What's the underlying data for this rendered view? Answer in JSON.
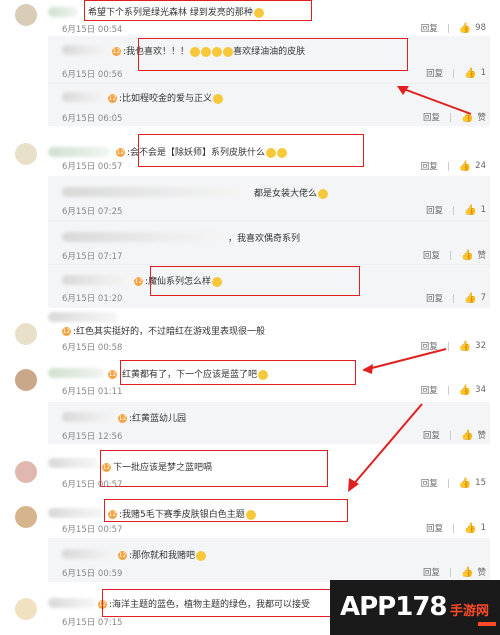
{
  "comments": [
    {
      "text": "希望下个系列是绿光森林 绿到发亮的那种",
      "time": "6月15日 00:54",
      "reply": "回复",
      "likes": "98",
      "replies": [
        {
          "text": "我也喜欢！！！",
          "text2": "喜欢绿油油的皮肤",
          "time": "6月15日 00:56",
          "reply": "回复",
          "likes": "1"
        },
        {
          "text": "比如程咬金的爱与正义",
          "time": "6月15日 06:05",
          "reply": "回复",
          "likes": "赞"
        }
      ]
    },
    {
      "text": "会不会是【除妖师】系列皮肤什么",
      "time": "6月15日 00:57",
      "reply": "回复",
      "likes": "24",
      "replies": [
        {
          "text": "都是女装大佬么",
          "time": "6月15日 07:25",
          "reply": "回复",
          "likes": "1"
        },
        {
          "text": "，我喜欢偶奇系列",
          "time": "6月15日 07:17",
          "reply": "回复",
          "likes": "赞"
        },
        {
          "text": "魔仙系列怎么样",
          "time": "6月15日 01:20",
          "reply": "回复",
          "likes": "7"
        }
      ]
    },
    {
      "text": "红色其实挺好的，不过暗红在游戏里表现很一般",
      "time": "6月15日 00:58",
      "reply": "回复",
      "likes": "32"
    },
    {
      "text": "红黄都有了，下一个应该是蓝了吧",
      "time": "6月15日 01:11",
      "reply": "回复",
      "likes": "34",
      "replies": [
        {
          "text": "红黄蓝幼儿园",
          "time": "6月15日 12:56",
          "reply": "回复",
          "likes": "赞"
        }
      ]
    },
    {
      "text": "下一批应该是梦之蓝吧嗝",
      "time": "6月15日 00:57",
      "reply": "回复",
      "likes": "15"
    },
    {
      "text": "我赌5毛下赛季皮肤银白色主题",
      "time": "6月15日 00:57",
      "reply": "回复",
      "likes": "1",
      "replies": [
        {
          "text": "那你就和我赌吧",
          "time": "6月15日 00:59",
          "reply": "回复",
          "likes": "赞"
        }
      ]
    },
    {
      "text": "海洋主题的蓝色，植物主题的绿色，我都可以接受",
      "time": "6月15日 07:15"
    }
  ],
  "watermark": {
    "main": "APP178",
    "sub": "手游网"
  },
  "colors": {
    "highlight": "#e02020",
    "reply_bg": "#f4f5f6"
  }
}
